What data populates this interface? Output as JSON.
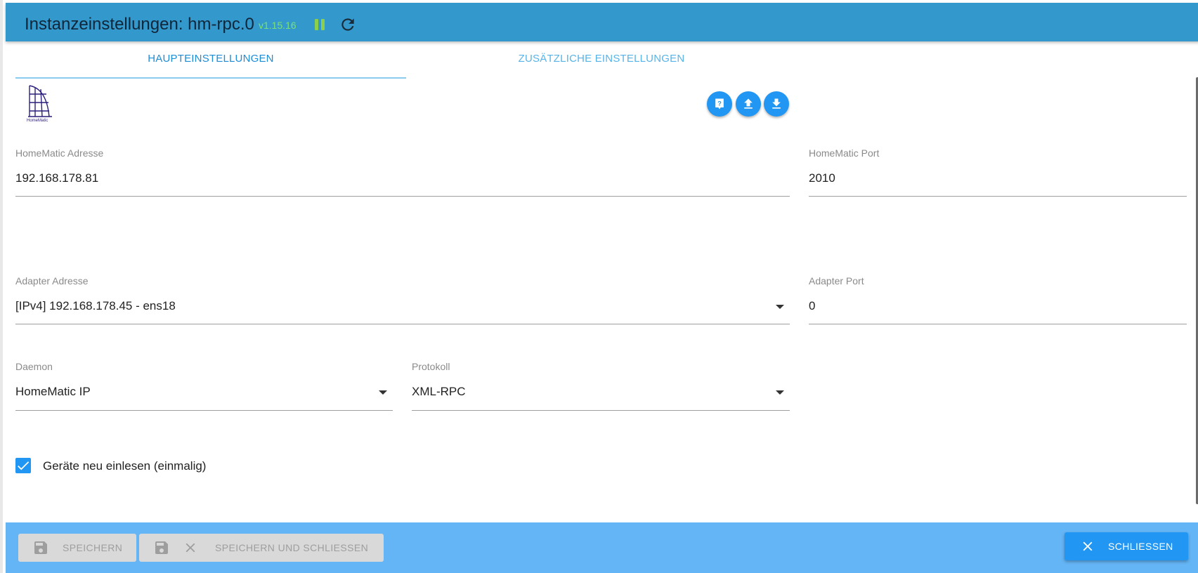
{
  "header": {
    "title": "Instanzeinstellungen: hm-rpc.0",
    "version": "v1.15.16",
    "pause_icon": "pause-icon",
    "reload_icon": "reload-icon"
  },
  "tabs": [
    {
      "label": "HAUPTEINSTELLUNGEN",
      "active": true
    },
    {
      "label": "ZUSÄTZLICHE EINSTELLUNGEN",
      "active": false
    }
  ],
  "logo": {
    "text": "HomeMatic"
  },
  "actions": {
    "help_icon": "help-icon",
    "upload_icon": "upload-icon",
    "download_icon": "download-icon"
  },
  "form": {
    "homematic_address": {
      "label": "HomeMatic Adresse",
      "value": "192.168.178.81"
    },
    "homematic_port": {
      "label": "HomeMatic Port",
      "value": "2010"
    },
    "adapter_address": {
      "label": "Adapter Adresse",
      "value": "[IPv4] 192.168.178.45 - ens18"
    },
    "adapter_port": {
      "label": "Adapter Port",
      "value": "0"
    },
    "daemon": {
      "label": "Daemon",
      "value": "HomeMatic IP"
    },
    "protocol": {
      "label": "Protokoll",
      "value": "XML-RPC"
    },
    "reread_devices": {
      "label": "Geräte neu einlesen (einmalig)",
      "checked": true
    }
  },
  "footer": {
    "save_label": "SPEICHERN",
    "save_close_label": "SPEICHERN UND SCHLIESSEN",
    "close_label": "SCHLIESSEN"
  },
  "colors": {
    "titlebar": "#3399cc",
    "accent": "#2196f3",
    "footer": "#64b5f6",
    "version": "#7be07b"
  }
}
